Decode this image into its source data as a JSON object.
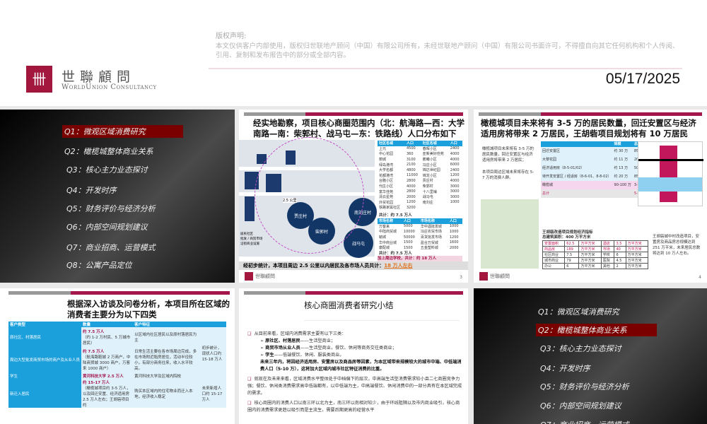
{
  "header": {
    "notice_title": "版权声明:",
    "notice_body": "本文仅供客户内部使用，版权归世联地产顾问（中国）有限公司所有，未经世联地产顾问（中国）有限公司书面许可，不得擅自向其它任何机构和个人传阅、引用、复制和发布报告中的部分或全部内容。",
    "logo_mark": "卌",
    "logo_cn": "世聯顧問",
    "logo_en": "WorldUnion Consultancy",
    "date": "05/17/2025"
  },
  "toc": [
    "Q1：微观区域消费研究",
    "Q2：橄榄城整体商业关系",
    "Q3：核心主力业态探讨",
    "Q4：开发时序",
    "Q5：财务评价与经济分析",
    "Q6：内部空间规划建议",
    "Q7：商业招商、运营模式",
    "Q8：公寓产品定位"
  ],
  "slide3": {
    "title": "经实地勘察，项目核心商圈范围内（北：航海路—西：大学南路—南：柴郭村、战马屯—东：铁路线）人口分布如下",
    "pop_header": [
      "社区名城",
      "人口",
      "社区名城",
      "人口"
    ],
    "pop_rows": [
      [
        "上元",
        "4500",
        "春晖小区",
        "2400"
      ],
      [
        "中心花园",
        "360",
        "亚新美好佳苑",
        "4000"
      ],
      [
        "丽城",
        "3100",
        "鹏曦小区",
        "4000"
      ],
      [
        "绿岛港湾",
        "2100",
        "冯庄小区",
        "6000"
      ],
      [
        "大学名都",
        "4800",
        "锦达世纪园",
        "2400"
      ],
      [
        "花都港湾",
        "11000",
        "锦龙小区",
        "1200"
      ],
      [
        "台胞小区",
        "2800",
        "贾庄村",
        "4000"
      ],
      [
        "代庄小区",
        "4000",
        "柴郭村",
        "3000"
      ],
      [
        "富华佳苑",
        "2800",
        "十八里铺",
        "3000"
      ],
      [
        "清云星苑",
        "2000",
        "战马屯",
        "3000"
      ],
      [
        "外贸花园",
        "1200",
        "南刘庄",
        "1000"
      ],
      [
        "铁路家属社区",
        "3200",
        "",
        ""
      ]
    ],
    "pop_total": "共计：约 7.5 万人",
    "mkt_header": [
      "市场名称",
      "人口",
      "市场名称",
      "人口"
    ],
    "mkt_rows": [
      [
        "万客来",
        "5000",
        "华中酒批发城",
        "1000"
      ],
      [
        "中陆商贸城",
        "10000",
        "冯庄农贸市场",
        "1000"
      ],
      [
        "毓城",
        "50000",
        "百货批发市场",
        "1200"
      ],
      [
        "华中商业城",
        "1500",
        "盈合万贸城",
        "1600"
      ],
      [
        "康配城",
        "1500",
        "五金塑料城",
        "2000"
      ]
    ],
    "mkt_total": "共计：约 7.5 万人",
    "school_total": "加上周边学校，共计：约 18 万人",
    "map_labels": [
      "贾庄村",
      "南刘庄村",
      "柴郭村",
      "战马屯",
      "2.5 公里"
    ],
    "legend": [
      "居民社区",
      "批发 / 商贸市场",
      "沿街商业设施"
    ],
    "bottom_prefix": "经初步统计，本项目周边 2.5 公里以内居民及各市场人员共计：",
    "bottom_value": "18 万人左右",
    "page": "3"
  },
  "slide4": {
    "title": "橄榄城项目未来将有 3-5 万的居民数量，回迁安置区与经济适用房将带来 2 万居民，王胡砦项目规划将有 10 万居民",
    "bullets": [
      "橄榄城项目未来将有 3-5 万的居民数量，回迁安置区与经济适用房将带来 2 万居民；",
      "本项目周边区域未来将存在 5-7 万的消费人群。"
    ],
    "table_header": [
      "",
      "规模",
      "总人口数"
    ],
    "table_rows": [
      [
        "回迁安置区",
        "约 30 万",
        "8500 人"
      ],
      [
        "大黎花园",
        "约 11 万",
        "2000 人"
      ],
      [
        "经济适用房（8-5-01/02）",
        "约 13 万",
        "5000 人"
      ],
      [
        "待开发安置区 / 经适房（8-6-01、8-8-02）",
        "约 20 万",
        "8500 人"
      ],
      [
        "橄榄城",
        "90-100 万",
        "3-5 万人"
      ],
      [
        "总计",
        "",
        "5-7 万人"
      ]
    ],
    "plan_title": "王胡砦改造项目规划经济指标",
    "plan_area": "总建筑面积：400 万平方米",
    "plan_rows": [
      [
        "安置面积",
        "62.5",
        "万平方米",
        "酒店",
        "3.5",
        "万平方米"
      ],
      [
        "商品房",
        "189",
        "万平方米",
        "市场",
        "40",
        "万平方米"
      ],
      [
        "社区商业",
        "7.5",
        "万平方米",
        "学校",
        "6",
        "万平方米"
      ],
      [
        "城市商业",
        "79",
        "万平方米",
        "医院",
        "4.5",
        "万平方米"
      ],
      [
        "办公",
        "6",
        "万平方米",
        "其他",
        "2",
        "万平方米"
      ]
    ],
    "note": "王胡砦城中村改造项目，安置房及商品房总规模达到 251 万平米，未来居民总数将达到 10 万人左右。",
    "page": "4"
  },
  "slide5": {
    "title": "根据深入访谈及问卷分析，本项目所在区域的消费者主要分为以下四类",
    "header": [
      "客户类型",
      "数量",
      "客户特征",
      ""
    ],
    "rows": [
      [
        "原社区、村落居民",
        "约 7.5 万人",
        "（约 1-2 万村民、5 万城市居民）",
        "以区域内社区居民以及原村落居民为主"
      ],
      [
        "周边大型批发商贸市场的商户及从业人员",
        "约 7.5 万人",
        "（航海路鞋城 2 万商户，中陆商贸城 3000 商户，万客来 1000 商户）",
        "日常生活主要在各市场周边完成，多在市场附近租房居住，活动半径较小，有部分商务往来，收入水平较高。"
      ],
      [
        "学生",
        "黄河科技大学 2.5 万人",
        "",
        "黄河科技大学及区域内院校"
      ],
      [
        "新迁入居民",
        "约 15-17 万人",
        "（橄榄城项目约 3-5 万人，以及回迁安置、经济适用房 2.5 万人左右；王胡砦项目约",
        "购买本区域内的住宅物业而迁入本地，经济收入稳定"
      ]
    ],
    "side_1": "初步统计，现状人口约 15-18 万人",
    "side_2": "未来新增人口约 15-17 万人"
  },
  "slide6": {
    "title": "核心商圈消费者研究小结",
    "p1": "从目前来看，区域内消费需求主要有以下三类：",
    "subs": [
      [
        "原社区、村落居民",
        "——生活型商业；"
      ],
      [
        "商贸市场从业人员",
        "——生活型商业，餐饮、休闲等商务交往类商业；"
      ],
      [
        "学生",
        "——低端餐饮、休闲、服装类商业。"
      ]
    ],
    "bold": "未来三年内，将因经济适用房、安置房以及商品房等因素，为本区域带来规模较大的城市中端、中低端消费人口（5-10 万），这将加大区域内城市社区特征消费的比重。",
    "p2": "就现在及未来来看，区域消费水平整体处于中档偏下的层次，中高端生活型消费需求较小且二七商圈竞争力强；餐饮、休闲类消费需求高中低端都有，以中低端为主，中高端餐饮、休闲消费中的一部分具有在本区域完成的需求。",
    "p3": "核心商圈内的消费人口以南三环以北为主，南三环以南相对较少，由于环线阻隔以及市内商业吸引，核心商圈内的消费需求更趋以吸引而是主流生，需要后期更高的经营水平"
  },
  "colors": {
    "brand": "#a3173f",
    "accent_bar": "#a3174d",
    "table_blue": "#1ca0dc",
    "toc_selected": "#7a0000"
  }
}
